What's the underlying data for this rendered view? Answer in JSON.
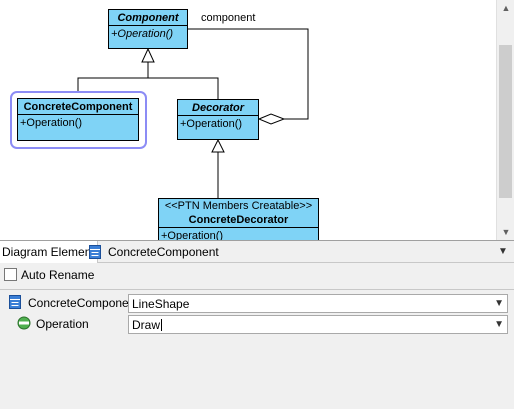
{
  "diagram": {
    "role_label": "component",
    "classes": {
      "component": {
        "name": "Component",
        "operation": "+Operation()"
      },
      "concrete_component": {
        "name": "ConcreteComponent",
        "operation": "+Operation()"
      },
      "decorator": {
        "name": "Decorator",
        "operation": "+Operation()"
      },
      "concrete_decorator": {
        "stereotype": "<<PTN Members Creatable>>",
        "name": "ConcreteDecorator",
        "operation": "+Operation()"
      }
    }
  },
  "panel": {
    "tab_label": "Diagram Element",
    "selected_element": "ConcreteComponent",
    "auto_rename_label": "Auto Rename",
    "auto_rename_checked": false,
    "rows": [
      {
        "label": "ConcreteComponent",
        "value": "LineShape",
        "icon": "class-icon"
      },
      {
        "label": "Operation",
        "value": "Draw",
        "icon": "operation-icon"
      }
    ]
  },
  "colors": {
    "class_fill": "#7fd3f6",
    "selection": "#8c8cf5"
  }
}
